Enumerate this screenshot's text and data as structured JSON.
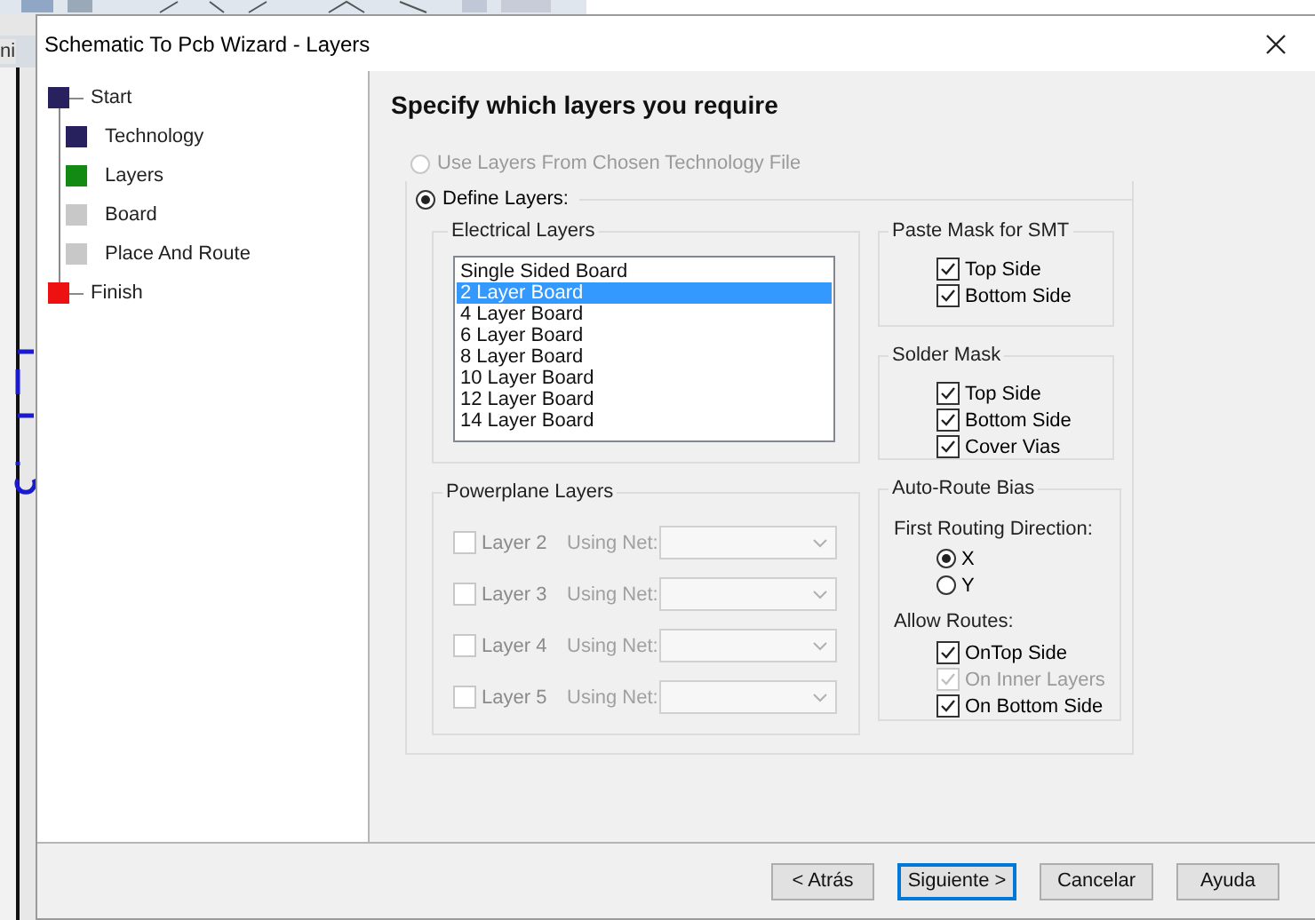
{
  "background_app": {
    "tab_label": "ni"
  },
  "window": {
    "title": "Schematic To Pcb Wizard - Layers"
  },
  "steps": [
    {
      "label": "Start",
      "color": "#27215e",
      "children": [
        {
          "label": "Technology",
          "color": "#27215e"
        },
        {
          "label": "Layers",
          "color": "#138a13"
        },
        {
          "label": "Board",
          "color": "#c8c8c8"
        },
        {
          "label": "Place And Route",
          "color": "#c8c8c8"
        }
      ]
    },
    {
      "label": "Finish",
      "color": "#ee1111"
    }
  ],
  "heading": "Specify which layers you require",
  "layer_source": [
    {
      "label": "Use Layers From Chosen Technology File",
      "selected": false,
      "disabled": true
    },
    {
      "label": "Define Layers:",
      "selected": true,
      "disabled": false
    }
  ],
  "electrical_layers": {
    "title": "Electrical Layers",
    "items": [
      {
        "label": "Single Sided Board",
        "selected": false
      },
      {
        "label": "2 Layer Board",
        "selected": true
      },
      {
        "label": "4 Layer Board",
        "selected": false
      },
      {
        "label": "6 Layer Board",
        "selected": false
      },
      {
        "label": "8 Layer Board",
        "selected": false
      },
      {
        "label": "10 Layer Board",
        "selected": false
      },
      {
        "label": "12 Layer Board",
        "selected": false
      },
      {
        "label": "14 Layer Board",
        "selected": false
      }
    ]
  },
  "powerplane_layers": {
    "title": "Powerplane Layers",
    "rows": [
      {
        "label": "Layer 2",
        "checked": false,
        "disabled": true,
        "net_label": "Using Net:"
      },
      {
        "label": "Layer 3",
        "checked": false,
        "disabled": true,
        "net_label": "Using Net:"
      },
      {
        "label": "Layer 4",
        "checked": false,
        "disabled": true,
        "net_label": "Using Net:"
      },
      {
        "label": "Layer 5",
        "checked": false,
        "disabled": true,
        "net_label": "Using Net:"
      }
    ]
  },
  "paste_mask": {
    "title": "Paste Mask for SMT",
    "options": [
      {
        "label": "Top Side",
        "checked": true,
        "disabled": false
      },
      {
        "label": "Bottom Side",
        "checked": true,
        "disabled": false
      }
    ]
  },
  "solder_mask": {
    "title": "Solder Mask",
    "options": [
      {
        "label": "Top Side",
        "checked": true,
        "disabled": false
      },
      {
        "label": "Bottom Side",
        "checked": true,
        "disabled": false
      },
      {
        "label": "Cover Vias",
        "checked": true,
        "disabled": false
      }
    ]
  },
  "auto_route_bias": {
    "title": "Auto-Route Bias",
    "direction_label": "First Routing Direction:",
    "directions": [
      {
        "label": "X",
        "selected": true
      },
      {
        "label": "Y",
        "selected": false
      }
    ],
    "routes_label": "Allow Routes:",
    "routes": [
      {
        "label": "OnTop Side",
        "checked": true,
        "disabled": false
      },
      {
        "label": "On Inner Layers",
        "checked": true,
        "disabled": true
      },
      {
        "label": "On Bottom Side",
        "checked": true,
        "disabled": false
      }
    ]
  },
  "buttons": [
    {
      "label": "< Atrás",
      "default": false
    },
    {
      "label": "Siguiente >",
      "default": true
    },
    {
      "label": "Cancelar",
      "default": false
    },
    {
      "label": "Ayuda",
      "default": false
    }
  ]
}
